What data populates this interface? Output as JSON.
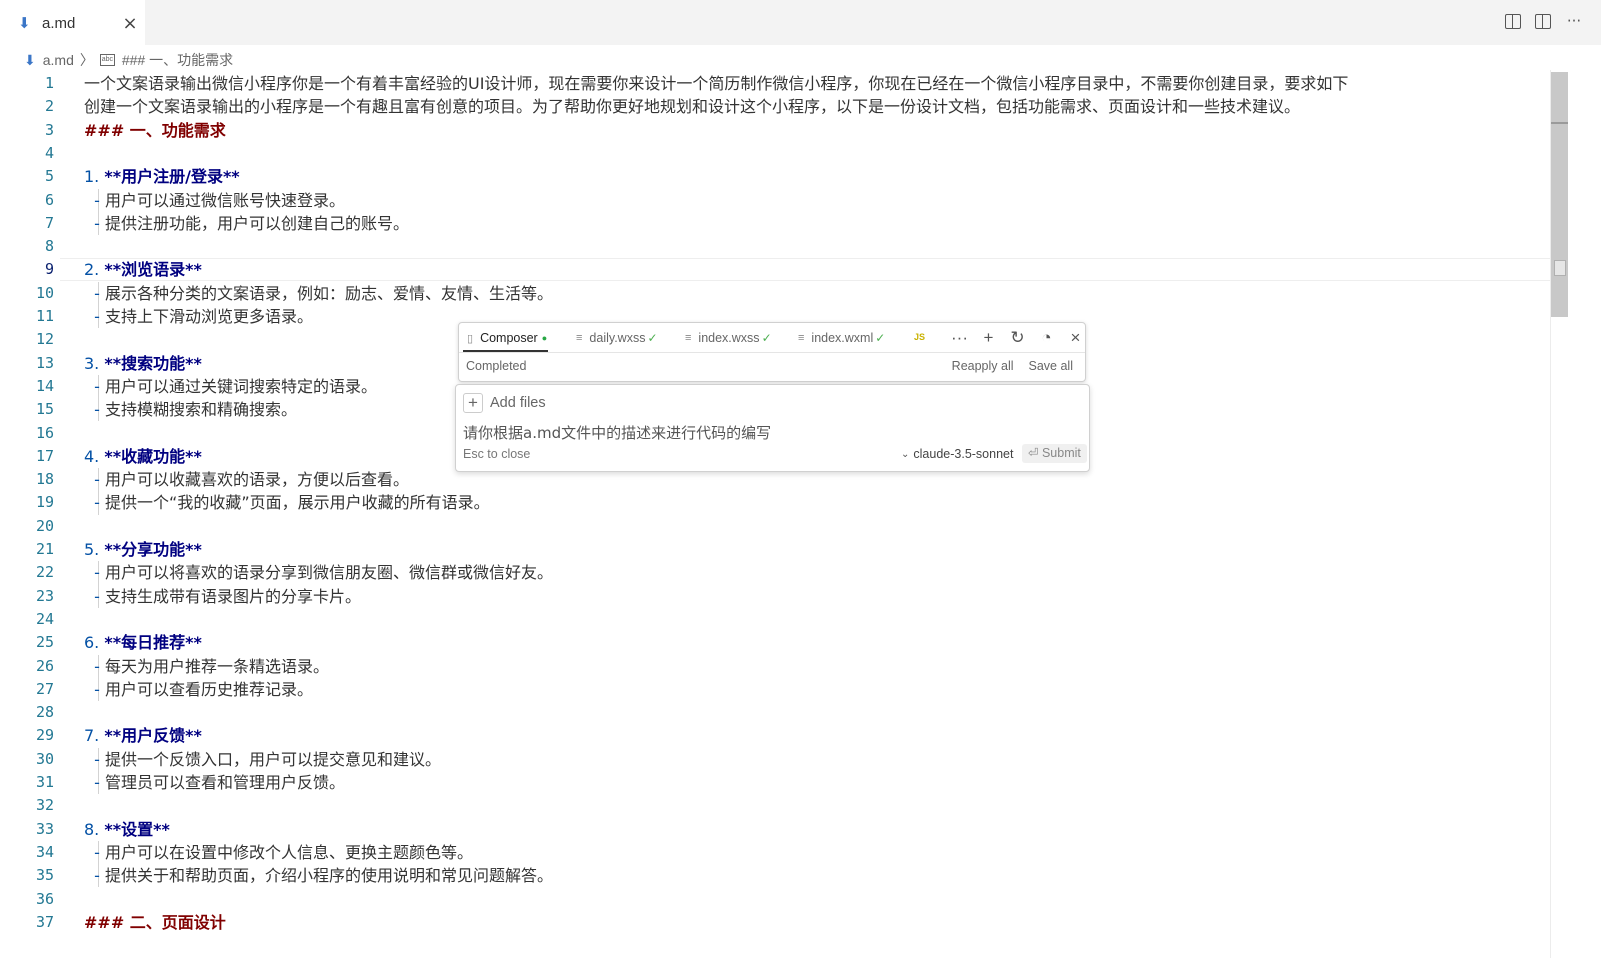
{
  "tab": {
    "filename": "a.md",
    "close": "×"
  },
  "tab_actions": {
    "more": "···"
  },
  "breadcrumb": {
    "file": "a.md",
    "separator": "〉",
    "section": "### 一、功能需求",
    "section_icon": "abc"
  },
  "editor": {
    "lines": [
      {
        "n": "1",
        "parts": [
          {
            "t": "一个文案语录输出微信小程序你是一个有着丰富经验的UI设计师，现在需要你来设计一个简历制作微信小程序，你现在已经在一个微信小程序目录中，不需要你创建目录，要求如下",
            "c": ""
          }
        ]
      },
      {
        "n": "2",
        "parts": [
          {
            "t": "创建一个文案语录输出的小程序是一个有趣且富有创意的项目。为了帮助你更好地规划和设计这个小程序，以下是一份设计文档，包括功能需求、页面设计和一些技术建议。",
            "c": ""
          }
        ]
      },
      {
        "n": "3",
        "parts": [
          {
            "t": "### 一、功能需求",
            "c": "h3"
          }
        ]
      },
      {
        "n": "4",
        "parts": []
      },
      {
        "n": "5",
        "parts": [
          {
            "t": "1. ",
            "c": "num"
          },
          {
            "t": "**用户注册/登录**",
            "c": "bold"
          }
        ]
      },
      {
        "n": "6",
        "guide": true,
        "parts": [
          {
            "t": "  - ",
            "c": "bullet"
          },
          {
            "t": "用户可以通过微信账号快速登录。",
            "c": ""
          }
        ]
      },
      {
        "n": "7",
        "guide": true,
        "parts": [
          {
            "t": "  - ",
            "c": "bullet"
          },
          {
            "t": "提供注册功能，用户可以创建自己的账号。",
            "c": ""
          }
        ]
      },
      {
        "n": "8",
        "parts": []
      },
      {
        "n": "9",
        "active": true,
        "parts": [
          {
            "t": "2. ",
            "c": "num"
          },
          {
            "t": "**浏览语录**",
            "c": "bold"
          }
        ]
      },
      {
        "n": "10",
        "guide": true,
        "parts": [
          {
            "t": "  - ",
            "c": "bullet"
          },
          {
            "t": "展示各种分类的文案语录，例如：励志、爱情、友情、生活等。",
            "c": ""
          }
        ]
      },
      {
        "n": "11",
        "guide": true,
        "parts": [
          {
            "t": "  - ",
            "c": "bullet"
          },
          {
            "t": "支持上下滑动浏览更多语录。",
            "c": ""
          }
        ]
      },
      {
        "n": "12",
        "parts": []
      },
      {
        "n": "13",
        "parts": [
          {
            "t": "3. ",
            "c": "num"
          },
          {
            "t": "**搜索功能**",
            "c": "bold"
          }
        ]
      },
      {
        "n": "14",
        "guide": true,
        "parts": [
          {
            "t": "  - ",
            "c": "bullet"
          },
          {
            "t": "用户可以通过关键词搜索特定的语录。",
            "c": ""
          }
        ]
      },
      {
        "n": "15",
        "guide": true,
        "parts": [
          {
            "t": "  - ",
            "c": "bullet"
          },
          {
            "t": "支持模糊搜索和精确搜索。",
            "c": ""
          }
        ]
      },
      {
        "n": "16",
        "parts": []
      },
      {
        "n": "17",
        "parts": [
          {
            "t": "4. ",
            "c": "num"
          },
          {
            "t": "**收藏功能**",
            "c": "bold"
          }
        ]
      },
      {
        "n": "18",
        "guide": true,
        "parts": [
          {
            "t": "  - ",
            "c": "bullet"
          },
          {
            "t": "用户可以收藏喜欢的语录，方便以后查看。",
            "c": ""
          }
        ]
      },
      {
        "n": "19",
        "guide": true,
        "parts": [
          {
            "t": "  - ",
            "c": "bullet"
          },
          {
            "t": "提供一个“我的收藏”页面，展示用户收藏的所有语录。",
            "c": ""
          }
        ]
      },
      {
        "n": "20",
        "parts": []
      },
      {
        "n": "21",
        "parts": [
          {
            "t": "5. ",
            "c": "num"
          },
          {
            "t": "**分享功能**",
            "c": "bold"
          }
        ]
      },
      {
        "n": "22",
        "guide": true,
        "parts": [
          {
            "t": "  - ",
            "c": "bullet"
          },
          {
            "t": "用户可以将喜欢的语录分享到微信朋友圈、微信群或微信好友。",
            "c": ""
          }
        ]
      },
      {
        "n": "23",
        "guide": true,
        "parts": [
          {
            "t": "  - ",
            "c": "bullet"
          },
          {
            "t": "支持生成带有语录图片的分享卡片。",
            "c": ""
          }
        ]
      },
      {
        "n": "24",
        "parts": []
      },
      {
        "n": "25",
        "parts": [
          {
            "t": "6. ",
            "c": "num"
          },
          {
            "t": "**每日推荐**",
            "c": "bold"
          }
        ]
      },
      {
        "n": "26",
        "guide": true,
        "parts": [
          {
            "t": "  - ",
            "c": "bullet"
          },
          {
            "t": "每天为用户推荐一条精选语录。",
            "c": ""
          }
        ]
      },
      {
        "n": "27",
        "guide": true,
        "parts": [
          {
            "t": "  - ",
            "c": "bullet"
          },
          {
            "t": "用户可以查看历史推荐记录。",
            "c": ""
          }
        ]
      },
      {
        "n": "28",
        "parts": []
      },
      {
        "n": "29",
        "parts": [
          {
            "t": "7. ",
            "c": "num"
          },
          {
            "t": "**用户反馈**",
            "c": "bold"
          }
        ]
      },
      {
        "n": "30",
        "guide": true,
        "parts": [
          {
            "t": "  - ",
            "c": "bullet"
          },
          {
            "t": "提供一个反馈入口，用户可以提交意见和建议。",
            "c": ""
          }
        ]
      },
      {
        "n": "31",
        "guide": true,
        "parts": [
          {
            "t": "  - ",
            "c": "bullet"
          },
          {
            "t": "管理员可以查看和管理用户反馈。",
            "c": ""
          }
        ]
      },
      {
        "n": "32",
        "parts": []
      },
      {
        "n": "33",
        "parts": [
          {
            "t": "8. ",
            "c": "num"
          },
          {
            "t": "**设置**",
            "c": "bold"
          }
        ]
      },
      {
        "n": "34",
        "guide": true,
        "parts": [
          {
            "t": "  - ",
            "c": "bullet"
          },
          {
            "t": "用户可以在设置中修改个人信息、更换主题颜色等。",
            "c": ""
          }
        ]
      },
      {
        "n": "35",
        "guide": true,
        "parts": [
          {
            "t": "  - ",
            "c": "bullet"
          },
          {
            "t": "提供关于和帮助页面，介绍小程序的使用说明和常见问题解答。",
            "c": ""
          }
        ]
      },
      {
        "n": "36",
        "parts": []
      },
      {
        "n": "37",
        "parts": [
          {
            "t": "### 二、页面设计",
            "c": "h3"
          }
        ]
      }
    ]
  },
  "composer": {
    "tabs": [
      {
        "label": "Composer",
        "name": "tab-composer",
        "icon": "▯",
        "active": true,
        "dot": "●"
      },
      {
        "label": "daily.wxss",
        "name": "tab-daily-wxss",
        "icon": "≡",
        "check": "✓"
      },
      {
        "label": "index.wxss",
        "name": "tab-index-wxss",
        "icon": "≡",
        "check": "✓"
      },
      {
        "label": "index.wxml",
        "name": "tab-index-wxml",
        "icon": "≡",
        "check": "✓"
      }
    ],
    "js_badge": "JS",
    "actions": {
      "more": "···",
      "new": "+",
      "refresh": "↻",
      "history": "◔",
      "close": "×"
    },
    "status": "Completed",
    "reapply": "Reapply all",
    "save": "Save all"
  },
  "composer_input": {
    "add_files": "Add files",
    "add_symbol": "+",
    "prompt": "请你根据a.md文件中的描述来进行代码的编写",
    "hint": "Esc to close",
    "model_chevron": "⌄",
    "model": "claude-3.5-sonnet",
    "submit": "⏎ Submit"
  },
  "colors": {
    "heading": "#800000",
    "bold": "#000080",
    "list_marker": "#0451a5",
    "line_number": "#237893"
  }
}
